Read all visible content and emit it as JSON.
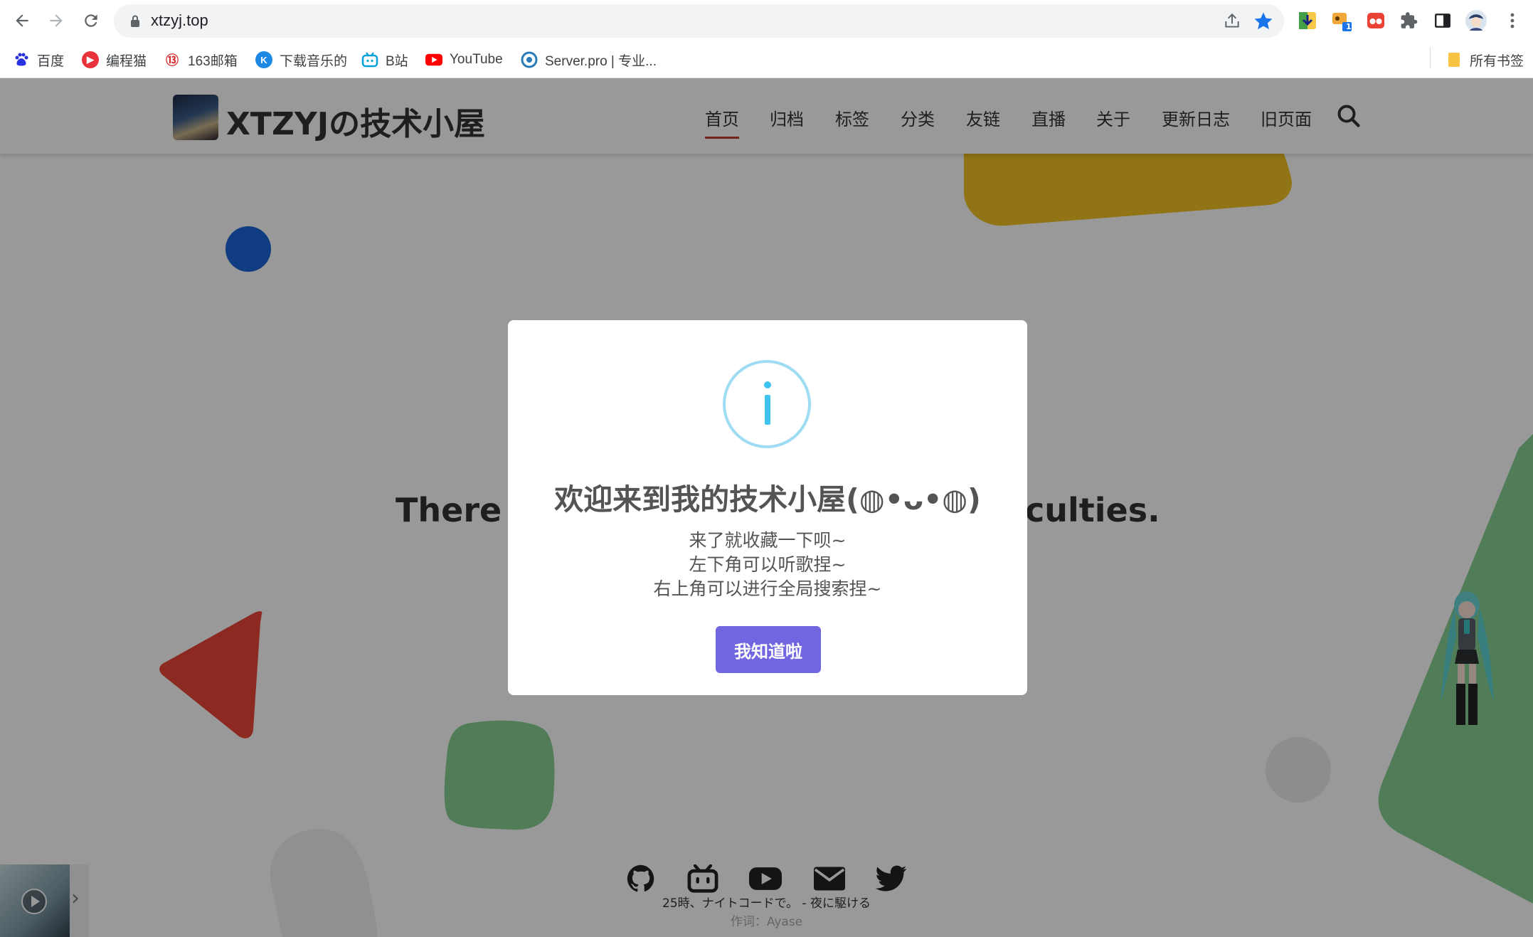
{
  "browser": {
    "url": "xtzyj.top",
    "extension_badge": "1",
    "bookmarks": [
      {
        "label": "百度",
        "icon": "baidu-icon"
      },
      {
        "label": "编程猫",
        "icon": "codemao-icon"
      },
      {
        "label": "163邮箱",
        "icon": "mail163-icon"
      },
      {
        "label": "下载音乐的",
        "icon": "kuwo-icon"
      },
      {
        "label": "B站",
        "icon": "bilibili-icon"
      },
      {
        "label": "YouTube",
        "icon": "youtube-icon"
      },
      {
        "label": "Server.pro | 专业...",
        "icon": "serverpro-icon"
      }
    ],
    "all_bookmarks": "所有书签"
  },
  "site": {
    "title": "XTZYJの技术小屋",
    "menu": [
      "首页",
      "归档",
      "标签",
      "分类",
      "友链",
      "直播",
      "关于",
      "更新日志",
      "旧页面"
    ],
    "hero_left": "There a",
    "hero_right": "culties.",
    "social_icons": [
      "github-icon",
      "bilibili-icon",
      "youtube-icon",
      "email-icon",
      "twitter-icon"
    ],
    "lyric": "25時、ナイトコードで。 - 夜に駆ける",
    "lyric_credit": "作词：Ayase"
  },
  "modal": {
    "icon": "info-icon",
    "title": "欢迎来到我的技术小屋(◍•ᴗ•◍)",
    "lines": [
      "来了就收藏一下呗~",
      "左下角可以听歌捏~",
      "右上角可以进行全局搜索捏~"
    ],
    "button": "我知道啦"
  },
  "colors": {
    "modal_button": "#7066e0",
    "info_icon": "#3fc3ee",
    "active_menu_underline": "#c0392b"
  }
}
